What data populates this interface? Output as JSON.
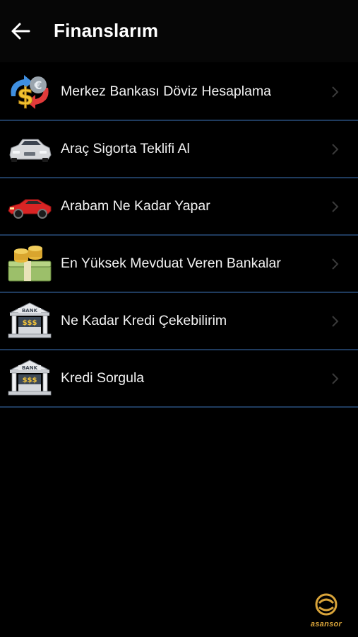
{
  "header": {
    "title": "Finanslarım",
    "back_icon": "arrow-left-icon"
  },
  "items": [
    {
      "label": "Merkez Bankası Döviz Hesaplama",
      "icon": "currency-exchange-icon"
    },
    {
      "label": "Araç Sigorta Teklifi Al",
      "icon": "silver-car-icon"
    },
    {
      "label": "Arabam Ne Kadar Yapar",
      "icon": "red-car-icon"
    },
    {
      "label": "En Yüksek Mevduat Veren Bankalar",
      "icon": "money-stack-icon"
    },
    {
      "label": "Ne Kadar Kredi Çekebilirim",
      "icon": "bank-icon"
    },
    {
      "label": "Kredi Sorgula",
      "icon": "bank-icon"
    }
  ],
  "branding": {
    "logo_text": "asansor"
  },
  "colors": {
    "background": "#000000",
    "divider": "#1f3b5e",
    "logo_accent": "#d9a43a"
  }
}
